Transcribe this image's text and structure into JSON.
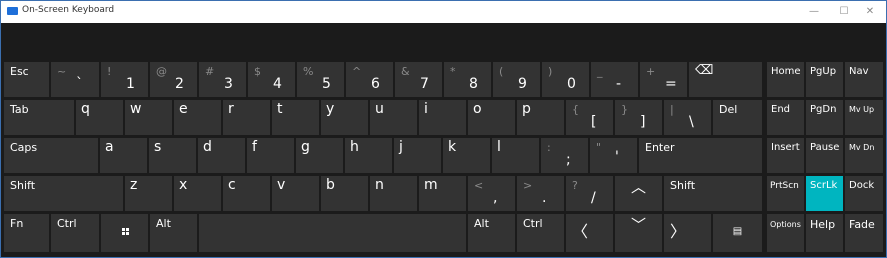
{
  "window": {
    "title": "On-Screen Keyboard",
    "minimize": "—",
    "maximize": "☐",
    "close": "✕"
  },
  "colors": {
    "key": "#333333",
    "background": "#1b1b1b",
    "highlight": "#00b5c0"
  },
  "keys": {
    "esc": "Esc",
    "num": [
      {
        "shift": "~",
        "main": "`"
      },
      {
        "shift": "!",
        "main": "1"
      },
      {
        "shift": "@",
        "main": "2"
      },
      {
        "shift": "#",
        "main": "3"
      },
      {
        "shift": "$",
        "main": "4"
      },
      {
        "shift": "%",
        "main": "5"
      },
      {
        "shift": "^",
        "main": "6"
      },
      {
        "shift": "&",
        "main": "7"
      },
      {
        "shift": "*",
        "main": "8"
      },
      {
        "shift": "(",
        "main": "9"
      },
      {
        "shift": ")",
        "main": "0"
      },
      {
        "shift": "_",
        "main": "-"
      },
      {
        "shift": "+",
        "main": "="
      }
    ],
    "backspace_icon": "⌫",
    "tab": "Tab",
    "row_q": [
      "q",
      "w",
      "e",
      "r",
      "t",
      "y",
      "u",
      "i",
      "o",
      "p"
    ],
    "lbracket": {
      "shift": "{",
      "main": "["
    },
    "rbracket": {
      "shift": "}",
      "main": "]"
    },
    "backslash": {
      "shift": "|",
      "main": "\\"
    },
    "del": "Del",
    "caps": "Caps",
    "row_a": [
      "a",
      "s",
      "d",
      "f",
      "g",
      "h",
      "j",
      "k",
      "l"
    ],
    "semicolon": {
      "shift": ":",
      "main": ";"
    },
    "quote": {
      "shift": "\"",
      "main": "'"
    },
    "enter": "Enter",
    "shift": "Shift",
    "row_z": [
      "z",
      "x",
      "c",
      "v",
      "b",
      "n",
      "m"
    ],
    "comma": {
      "shift": "<",
      "main": ","
    },
    "period": {
      "shift": ">",
      "main": "."
    },
    "slash": {
      "shift": "?",
      "main": "/"
    },
    "up_arrow": "︿",
    "fn": "Fn",
    "ctrl": "Ctrl",
    "alt": "Alt",
    "left_arrow": "〈",
    "down_arrow": "﹀",
    "right_arrow": "〉",
    "menu_icon": "▤",
    "nav": [
      [
        "Home",
        "PgUp",
        "Nav"
      ],
      [
        "End",
        "PgDn",
        "Mv Up"
      ],
      [
        "Insert",
        "Pause",
        "Mv Dn"
      ],
      [
        "PrtScn",
        "ScrLk",
        "Dock"
      ],
      [
        "Options",
        "Help",
        "Fade"
      ]
    ]
  }
}
